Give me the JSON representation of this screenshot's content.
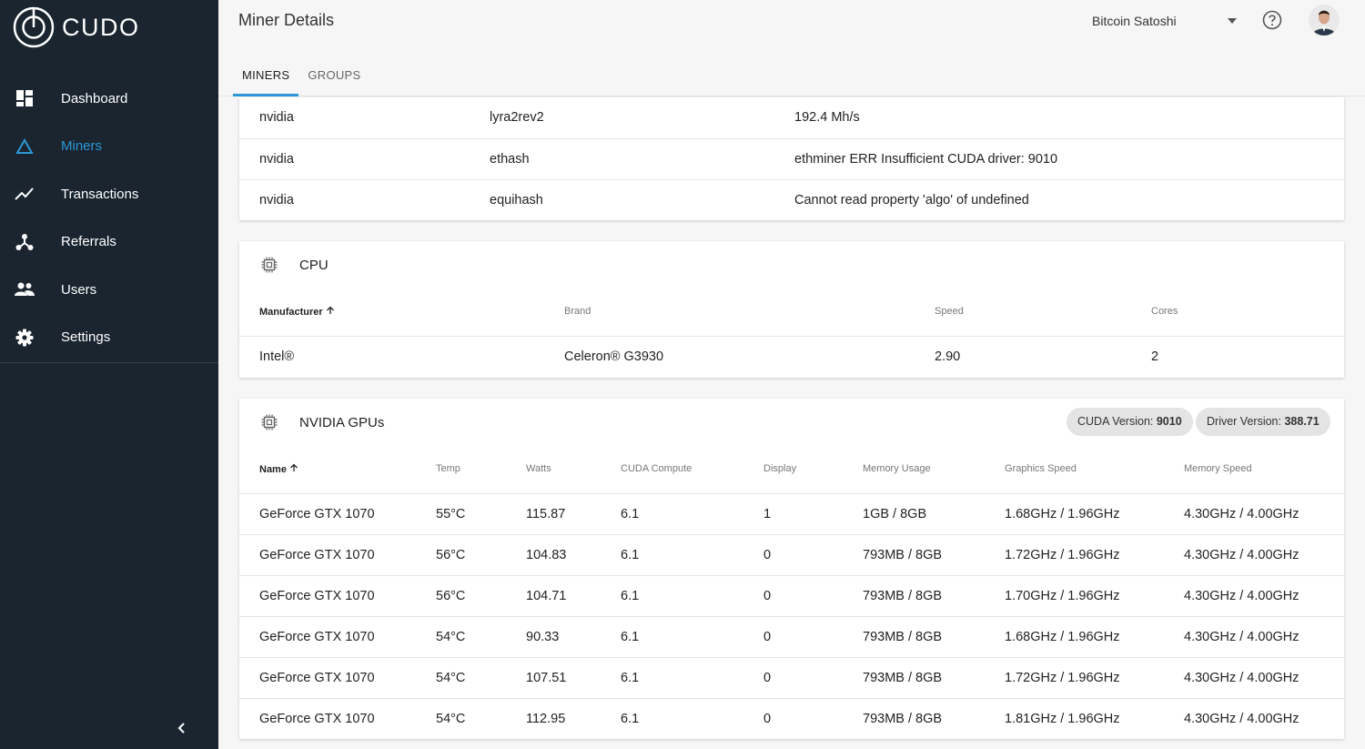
{
  "brand": {
    "name": "CUDO"
  },
  "nav": {
    "items": [
      {
        "label": "Dashboard",
        "icon": "dashboard-icon"
      },
      {
        "label": "Miners",
        "icon": "triangle-icon",
        "active": true
      },
      {
        "label": "Transactions",
        "icon": "trend-icon"
      },
      {
        "label": "Referrals",
        "icon": "referrals-icon"
      },
      {
        "label": "Users",
        "icon": "users-icon"
      },
      {
        "label": "Settings",
        "icon": "gear-icon"
      }
    ]
  },
  "header": {
    "title": "Miner Details",
    "user": "Bitcoin Satoshi",
    "tabs": [
      {
        "label": "MINERS",
        "active": true
      },
      {
        "label": "GROUPS"
      }
    ]
  },
  "algorithms": {
    "rows": [
      {
        "device": "nvidia",
        "algo": "lyra2rev2",
        "status": "192.4 Mh/s"
      },
      {
        "device": "nvidia",
        "algo": "ethash",
        "status": "ethminer ERR Insufficient CUDA driver: 9010"
      },
      {
        "device": "nvidia",
        "algo": "equihash",
        "status": "Cannot read property 'algo' of undefined"
      }
    ]
  },
  "cpu": {
    "title": "CPU",
    "columns": [
      "Manufacturer",
      "Brand",
      "Speed",
      "Cores"
    ],
    "rows": [
      {
        "manufacturer": "Intel®",
        "brand": "Celeron® G3930",
        "speed": "2.90",
        "cores": "2"
      }
    ]
  },
  "gpu": {
    "title": "NVIDIA GPUs",
    "cuda_label": "CUDA Version:",
    "cuda_value": "9010",
    "driver_label": "Driver Version:",
    "driver_value": "388.71",
    "columns": [
      "Name",
      "Temp",
      "Watts",
      "CUDA Compute",
      "Display",
      "Memory Usage",
      "Graphics Speed",
      "Memory Speed"
    ],
    "rows": [
      {
        "name": "GeForce GTX 1070",
        "temp": "55°C",
        "watts": "115.87",
        "compute": "6.1",
        "display": "1",
        "memory": "1GB / 8GB",
        "graphics": "1.68GHz / 1.96GHz",
        "mem_speed": "4.30GHz / 4.00GHz"
      },
      {
        "name": "GeForce GTX 1070",
        "temp": "56°C",
        "watts": "104.83",
        "compute": "6.1",
        "display": "0",
        "memory": "793MB / 8GB",
        "graphics": "1.72GHz / 1.96GHz",
        "mem_speed": "4.30GHz / 4.00GHz"
      },
      {
        "name": "GeForce GTX 1070",
        "temp": "56°C",
        "watts": "104.71",
        "compute": "6.1",
        "display": "0",
        "memory": "793MB / 8GB",
        "graphics": "1.70GHz / 1.96GHz",
        "mem_speed": "4.30GHz / 4.00GHz"
      },
      {
        "name": "GeForce GTX 1070",
        "temp": "54°C",
        "watts": "90.33",
        "compute": "6.1",
        "display": "0",
        "memory": "793MB / 8GB",
        "graphics": "1.68GHz / 1.96GHz",
        "mem_speed": "4.30GHz / 4.00GHz"
      },
      {
        "name": "GeForce GTX 1070",
        "temp": "54°C",
        "watts": "107.51",
        "compute": "6.1",
        "display": "0",
        "memory": "793MB / 8GB",
        "graphics": "1.72GHz / 1.96GHz",
        "mem_speed": "4.30GHz / 4.00GHz"
      },
      {
        "name": "GeForce GTX 1070",
        "temp": "54°C",
        "watts": "112.95",
        "compute": "6.1",
        "display": "0",
        "memory": "793MB / 8GB",
        "graphics": "1.81GHz / 1.96GHz",
        "mem_speed": "4.30GHz / 4.00GHz"
      }
    ]
  },
  "colors": {
    "sidebar": "#1a2530",
    "accent": "#2e97d6"
  }
}
